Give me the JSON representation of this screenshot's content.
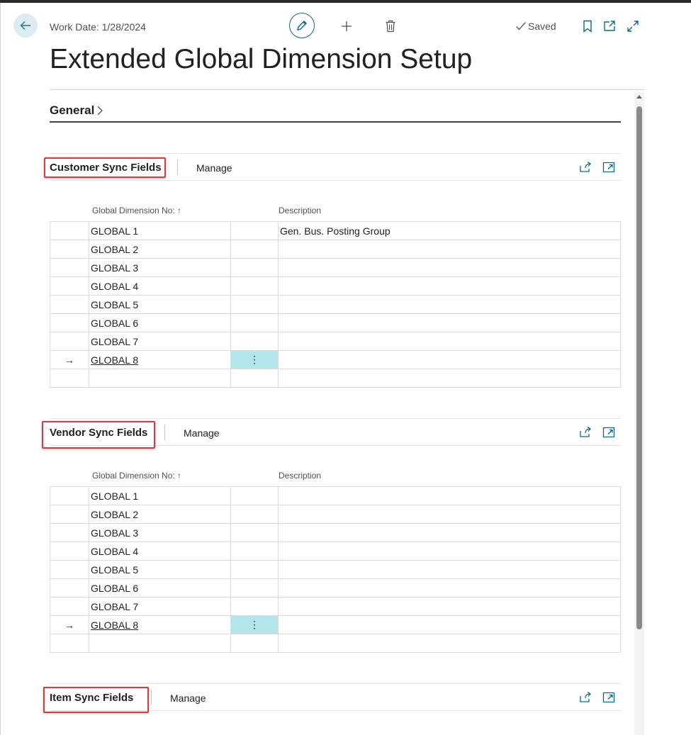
{
  "header": {
    "work_date": "Work Date: 1/28/2024",
    "saved_label": "Saved",
    "page_title": "Extended Global Dimension Setup"
  },
  "general": {
    "label": "General"
  },
  "colors": {
    "accent": "#0b6a80",
    "highlight": "#d9393f",
    "selected_cell": "#b3e6ea"
  },
  "parts": [
    {
      "title": "Customer Sync Fields",
      "manage_label": "Manage",
      "columns": {
        "global_dimension": "Global Dimension No: ↑",
        "description": "Description"
      },
      "rows": [
        {
          "dim": "GLOBAL 1",
          "desc": "Gen. Bus. Posting Group"
        },
        {
          "dim": "GLOBAL 2",
          "desc": ""
        },
        {
          "dim": "GLOBAL 3",
          "desc": ""
        },
        {
          "dim": "GLOBAL 4",
          "desc": ""
        },
        {
          "dim": "GLOBAL 5",
          "desc": ""
        },
        {
          "dim": "GLOBAL 6",
          "desc": ""
        },
        {
          "dim": "GLOBAL 7",
          "desc": ""
        },
        {
          "dim": "GLOBAL 8",
          "desc": ""
        }
      ],
      "row_arrow": "→",
      "row_menu": "⋮"
    },
    {
      "title": "Vendor Sync Fields",
      "manage_label": "Manage",
      "columns": {
        "global_dimension": "Global Dimension No: ↑",
        "description": "Description"
      },
      "rows": [
        {
          "dim": "GLOBAL 1",
          "desc": ""
        },
        {
          "dim": "GLOBAL 2",
          "desc": ""
        },
        {
          "dim": "GLOBAL 3",
          "desc": ""
        },
        {
          "dim": "GLOBAL 4",
          "desc": ""
        },
        {
          "dim": "GLOBAL 5",
          "desc": ""
        },
        {
          "dim": "GLOBAL 6",
          "desc": ""
        },
        {
          "dim": "GLOBAL 7",
          "desc": ""
        },
        {
          "dim": "GLOBAL 8",
          "desc": ""
        }
      ],
      "row_arrow": "→",
      "row_menu": "⋮"
    },
    {
      "title": "Item Sync Fields",
      "manage_label": "Manage"
    }
  ]
}
